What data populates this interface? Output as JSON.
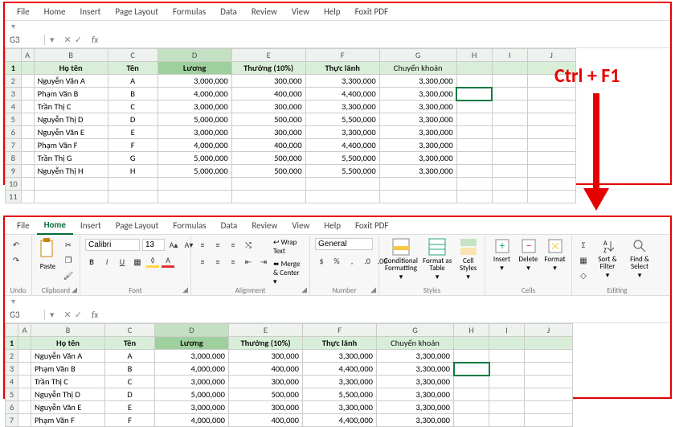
{
  "tabs": [
    "File",
    "Home",
    "Insert",
    "Page Layout",
    "Formulas",
    "Data",
    "Review",
    "View",
    "Help",
    "Foxit PDF"
  ],
  "activeTab": "Home",
  "namebox": "G3",
  "fx": "fx",
  "collapsedGlyph": "▾",
  "columns": {
    "B": "Họ tên",
    "C": "Tên",
    "D": "Lương",
    "E": "Thưởng (10%)",
    "F": "Thực lãnh",
    "G": "Chuyển khoản"
  },
  "colLetters": [
    "A",
    "B",
    "C",
    "D",
    "E",
    "F",
    "G",
    "H",
    "I",
    "J"
  ],
  "rows": [
    {
      "ho": "Nguyễn Văn A",
      "ten": "A",
      "luong": "3,000,000",
      "thuong": "300,000",
      "thuc": "3,300,000",
      "ck": "3,300,000"
    },
    {
      "ho": "Phạm Văn B",
      "ten": "B",
      "luong": "4,000,000",
      "thuong": "400,000",
      "thuc": "4,400,000",
      "ck": "3,300,000"
    },
    {
      "ho": "Trần Thị C",
      "ten": "C",
      "luong": "3,000,000",
      "thuong": "300,000",
      "thuc": "3,300,000",
      "ck": "3,300,000"
    },
    {
      "ho": "Nguyễn Thị D",
      "ten": "D",
      "luong": "5,000,000",
      "thuong": "500,000",
      "thuc": "5,500,000",
      "ck": "3,300,000"
    },
    {
      "ho": "Nguyễn Văn E",
      "ten": "E",
      "luong": "3,000,000",
      "thuong": "300,000",
      "thuc": "3,300,000",
      "ck": "3,300,000"
    },
    {
      "ho": "Phạm Văn F",
      "ten": "F",
      "luong": "4,000,000",
      "thuong": "400,000",
      "thuc": "4,400,000",
      "ck": "3,300,000"
    },
    {
      "ho": "Trần Thị G",
      "ten": "G",
      "luong": "5,000,000",
      "thuong": "500,000",
      "thuc": "5,500,000",
      "ck": "3,300,000"
    },
    {
      "ho": "Nguyễn Thị H",
      "ten": "H",
      "luong": "5,000,000",
      "thuong": "500,000",
      "thuc": "5,500,000",
      "ck": "3,300,000"
    }
  ],
  "bottomRowsCount": 6,
  "ribbon": {
    "undo": "Undo",
    "clipboard": "Clipboard",
    "paste": "Paste",
    "font": {
      "label": "Font",
      "name": "Calibri",
      "size": "13"
    },
    "alignment": {
      "label": "Alignment",
      "wrap": "Wrap Text",
      "merge": "Merge & Center"
    },
    "number": {
      "label": "Number",
      "format": "General"
    },
    "styles": {
      "label": "Styles",
      "cond": "Conditional Formatting",
      "table": "Format as Table",
      "cell": "Cell Styles"
    },
    "cells": {
      "label": "Cells",
      "insert": "Insert",
      "delete": "Delete",
      "format": "Format"
    },
    "editing": {
      "label": "Editing",
      "sort": "Sort & Filter",
      "find": "Find & Select"
    }
  },
  "annotation": "Ctrl + F1"
}
